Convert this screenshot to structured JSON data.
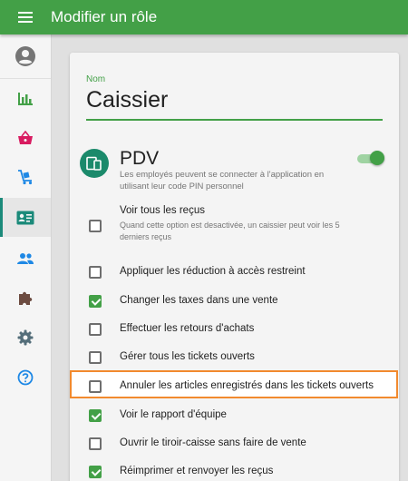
{
  "appbar": {
    "title": "Modifier un rôle",
    "menu_icon": "menu-icon"
  },
  "sidebar": {
    "avatar_icon": "account-circle-icon",
    "items": [
      {
        "icon": "bar-chart-icon",
        "color": "#43a047"
      },
      {
        "icon": "basket-icon",
        "color": "#d81b60"
      },
      {
        "icon": "cart-icon",
        "color": "#1e88e5"
      },
      {
        "icon": "id-card-icon",
        "color": "#1b8a7a",
        "active": true
      },
      {
        "icon": "people-icon",
        "color": "#1e88e5"
      },
      {
        "icon": "puzzle-icon",
        "color": "#6d4c41"
      },
      {
        "icon": "gear-icon",
        "color": "#546e7a"
      },
      {
        "icon": "help-icon",
        "color": "#1e88e5"
      }
    ]
  },
  "form": {
    "name_label": "Nom",
    "name_value": "Caissier"
  },
  "pdv": {
    "title": "PDV",
    "description": "Les employés peuvent se connecter à l'application en utilisant leur code PIN personnel",
    "enabled": true
  },
  "permissions": [
    {
      "label": "Voir tous les reçus",
      "sublabel": "Quand cette option est desactivée, un caissier peut voir les 5 derniers reçus",
      "checked": false
    },
    {
      "label": "Appliquer les réduction à accès restreint",
      "checked": false
    },
    {
      "label": "Changer les taxes dans une vente",
      "checked": true
    },
    {
      "label": "Effectuer les retours d'achats",
      "checked": false
    },
    {
      "label": "Gérer tous les tickets ouverts",
      "checked": false
    },
    {
      "label": "Annuler les articles enregistrés dans les tickets ouverts",
      "checked": false,
      "highlighted": true
    },
    {
      "label": "Voir le rapport d'équipe",
      "checked": true
    },
    {
      "label": "Ouvrir le tiroir-caisse sans faire de vente",
      "checked": false
    },
    {
      "label": "Réimprimer et renvoyer les reçus",
      "checked": true
    }
  ],
  "colors": {
    "primary": "#43a047",
    "highlight_border": "#f28a2e",
    "accent_teal": "#1b8a7a"
  }
}
